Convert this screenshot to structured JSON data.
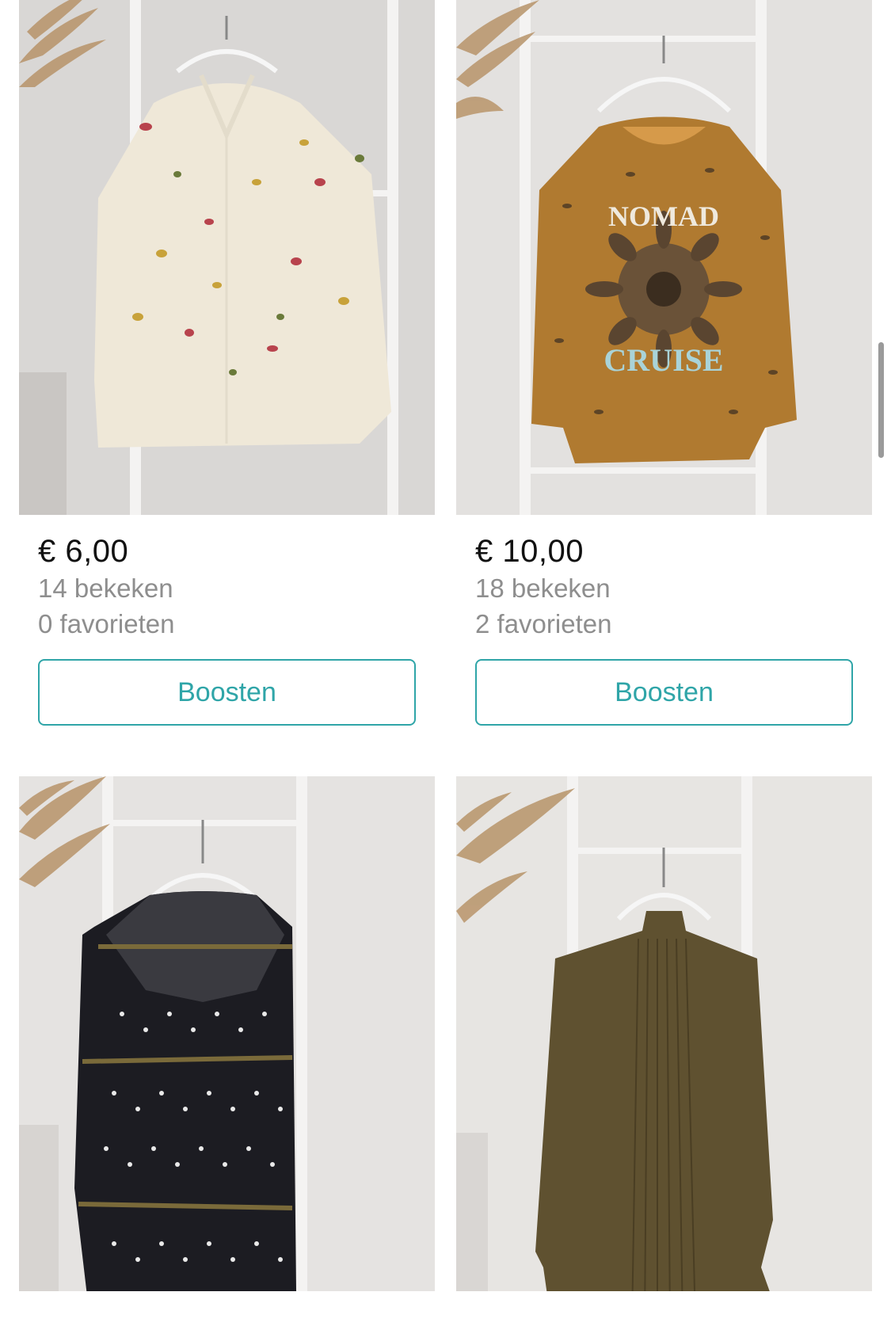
{
  "listings": [
    {
      "image_alt": "Crème blouse met insectenprint",
      "price": "€ 6,00",
      "views": "14 bekeken",
      "favorites": "0 favorieten",
      "boost_label": "Boosten",
      "colors": {
        "garment": "#efe8d8",
        "background": "#d8d6d4"
      }
    },
    {
      "image_alt": "Okergele sweater NOMAD CRUISE",
      "price": "€ 10,00",
      "views": "18 bekeken",
      "favorites": "2 favorieten",
      "boost_label": "Boosten",
      "colors": {
        "garment": "#b07a30",
        "background": "#e2e0de"
      }
    },
    {
      "image_alt": "Zwarte jurk met stippen",
      "colors": {
        "garment": "#1c1c22",
        "background": "#e4e2e0"
      }
    },
    {
      "image_alt": "Olijfgroene jurk met plooien",
      "colors": {
        "garment": "#5f5130",
        "background": "#e6e4e1"
      }
    }
  ],
  "graphic_text": {
    "sweater_top": "NOMAD",
    "sweater_bottom": "CRUISE"
  },
  "colors": {
    "accent": "#2fa5a8",
    "muted_text": "#8e8e8e"
  }
}
